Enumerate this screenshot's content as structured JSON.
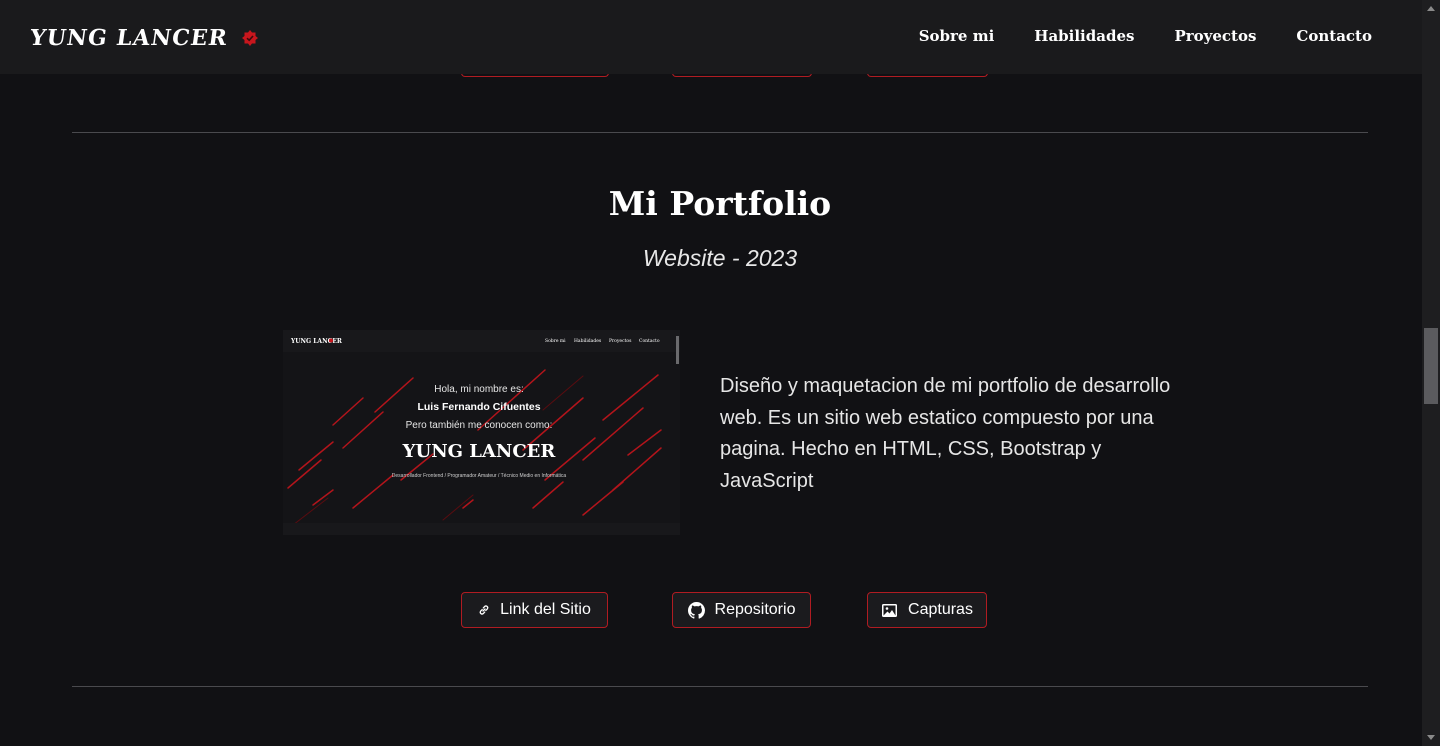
{
  "navbar": {
    "brand": "YUNG LANCER",
    "links": [
      "Sobre mi",
      "Habilidades",
      "Proyectos",
      "Contacto"
    ]
  },
  "project": {
    "title": "Mi Portfolio",
    "subtitle": "Website - 2023",
    "description": "Diseño y maquetacion de mi portfolio de desarrollo web. Es un sitio web estatico compuesto por una pagina. Hecho en HTML, CSS, Bootstrap y JavaScript",
    "preview": {
      "nav_links": [
        "Sobre mi",
        "Habilidades",
        "Proyectos",
        "Contacto"
      ],
      "greeting": "Hola, mi nombre es:",
      "name": "Luis Fernando Cifuentes",
      "aka": "Pero también me conocen como:",
      "alias": "YUNG LANCER",
      "roles": "Desarrollador Frontend / Programador Amateur / Técnico Medio en Informática"
    },
    "buttons": [
      {
        "label": "Link del Sitio",
        "icon": "link-icon"
      },
      {
        "label": "Repositorio",
        "icon": "github-icon"
      },
      {
        "label": "Capturas",
        "icon": "image-icon"
      }
    ]
  },
  "colors": {
    "background": "#111114",
    "navbar": "#1a1a1c",
    "accent": "#b01c22"
  }
}
